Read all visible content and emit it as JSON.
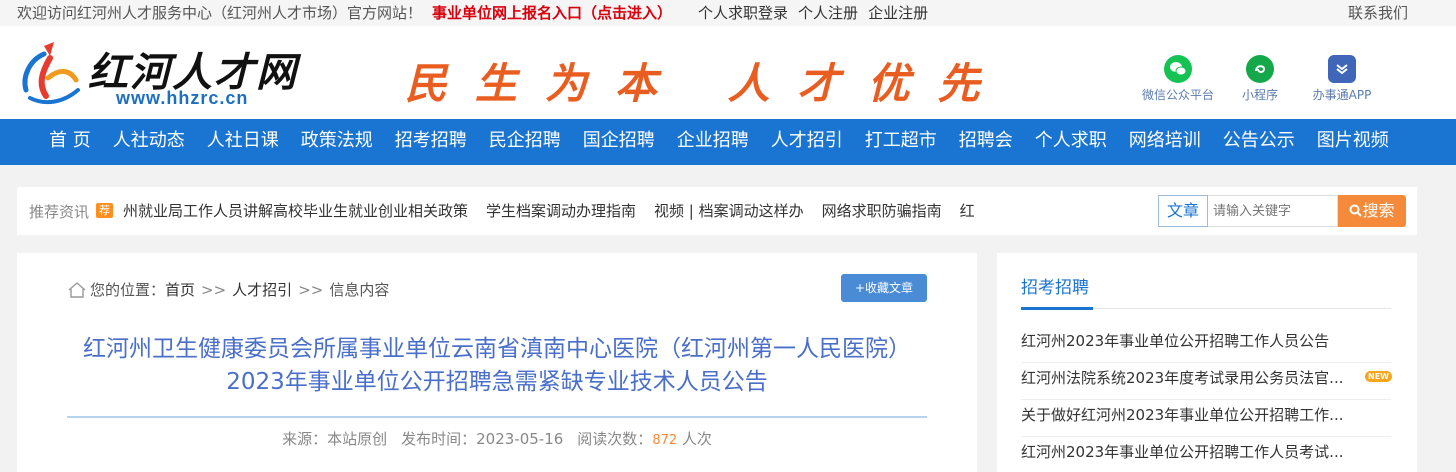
{
  "topbar": {
    "welcome": "欢迎访问红河州人才服务中心（红河州人才市场）官方网站！",
    "highlight_link": "事业单位网上报名入口（点击进入）",
    "links": [
      "个人求职登录",
      "个人注册",
      "企业注册"
    ],
    "contact": "联系我们"
  },
  "header": {
    "logo_name": "红河人才网",
    "logo_url": "www.hhzrc.cn",
    "slogan": "民生为本 人才优先",
    "icons": [
      {
        "label": "微信公众平台",
        "icon": "wechat-icon"
      },
      {
        "label": "小程序",
        "icon": "mini-program-icon"
      },
      {
        "label": "办事通APP",
        "icon": "app-icon"
      }
    ]
  },
  "nav": {
    "items": [
      "首 页",
      "人社动态",
      "人社日课",
      "政策法规",
      "招考招聘",
      "民企招聘",
      "国企招聘",
      "企业招聘",
      "人才招引",
      "打工超市",
      "招聘会",
      "个人求职",
      "网络培训",
      "公告公示",
      "图片视频"
    ]
  },
  "recommend": {
    "label": "推荐资讯",
    "badge": "荐",
    "items": [
      "州就业局工作人员讲解高校毕业生就业创业相关政策",
      "学生档案调动办理指南",
      "视频 | 档案调动这样办",
      "网络求职防骗指南",
      "红"
    ]
  },
  "search": {
    "category": "文章",
    "placeholder": "请输入关键字",
    "button": "搜索"
  },
  "article": {
    "breadcrumb_label": "您的位置：",
    "breadcrumb": [
      "首页",
      "人才招引",
      "信息内容"
    ],
    "breadcrumb_sep": ">>",
    "fav_button": "+收藏文章",
    "title": "红河州卫生健康委员会所属事业单位云南省滇南中心医院（红河州第一人民医院）2023年事业单位公开招聘急需紧缺专业技术人员公告",
    "source_label": "来源：",
    "source": "本站原创",
    "time_label": "发布时间：",
    "time": "2023-05-16",
    "views_label": "阅读次数：",
    "views": "872",
    "views_unit": "人次"
  },
  "sidebar": {
    "heading": "招考招聘",
    "items": [
      {
        "text": "红河州2023年事业单位公开招聘工作人员公告",
        "new": ""
      },
      {
        "text": "红河州法院系统2023年度考试录用公务员法官...",
        "new": "NEW"
      },
      {
        "text": "关于做好红河州2023年事业单位公开招聘工作...",
        "new": ""
      },
      {
        "text": "红河州2023年事业单位公开招聘工作人员考试...",
        "new": ""
      }
    ]
  },
  "colors": {
    "nav_bg": "#1a74d1",
    "slogan": "#ea5d21",
    "highlight": "#d8000c",
    "search_btn": "#f58b3a",
    "title": "#4a6fc9"
  }
}
